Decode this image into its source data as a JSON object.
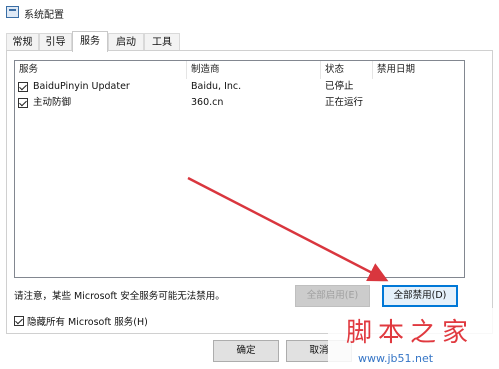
{
  "window": {
    "title": "系统配置"
  },
  "tabs": [
    {
      "label": "常规"
    },
    {
      "label": "引导"
    },
    {
      "label": "服务"
    },
    {
      "label": "启动"
    },
    {
      "label": "工具"
    }
  ],
  "services_list": {
    "headers": {
      "service": "服务",
      "manufacturer": "制造商",
      "status": "状态",
      "disabled_date": "禁用日期"
    },
    "rows": [
      {
        "checked": true,
        "service": "BaiduPinyin Updater",
        "manufacturer": "Baidu, Inc.",
        "status": "已停止",
        "disabled_date": ""
      },
      {
        "checked": true,
        "service": "主动防御",
        "manufacturer": "360.cn",
        "status": "正在运行",
        "disabled_date": ""
      }
    ]
  },
  "note": "请注意，某些 Microsoft 安全服务可能无法禁用。",
  "buttons": {
    "enable_all": "全部启用(E)",
    "disable_all": "全部禁用(D)",
    "ok": "确定",
    "cancel": "取消"
  },
  "hide_microsoft": {
    "checked": true,
    "label": "隐藏所有 Microsoft 服务(H)"
  },
  "watermark": {
    "title": "脚本之家",
    "url": "www.jb51.net"
  },
  "colors": {
    "accent": "#0078d7",
    "arrow": "#d9363e",
    "watermark_title": "#e0393f",
    "watermark_url": "#3575c6"
  }
}
